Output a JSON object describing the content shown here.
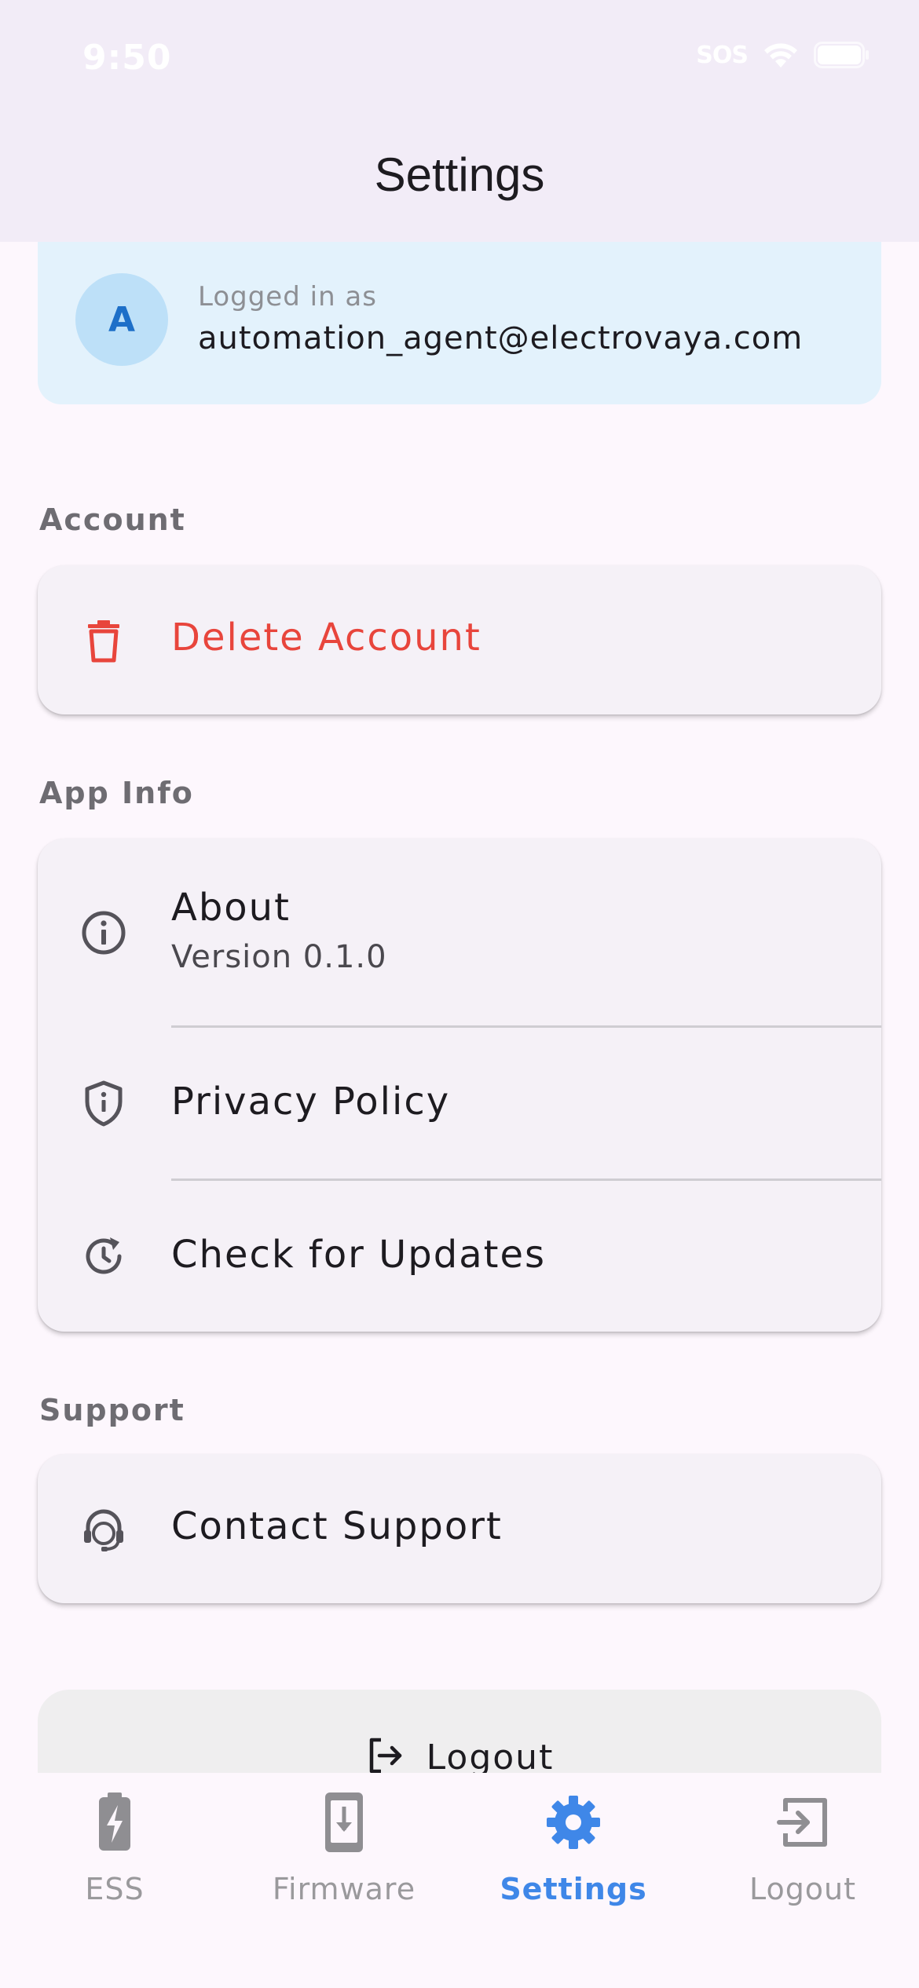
{
  "status_bar": {
    "time": "9:50",
    "sos": "SOS"
  },
  "header": {
    "title": "Settings"
  },
  "user": {
    "avatar_letter": "A",
    "logged_in_label": "Logged in as",
    "email": "automation_agent@electrovaya.com"
  },
  "sections": {
    "account": {
      "label": "Account",
      "delete_label": "Delete Account"
    },
    "app_info": {
      "label": "App Info",
      "about_title": "About",
      "about_version": "Version 0.1.0",
      "privacy_label": "Privacy Policy",
      "updates_label": "Check for Updates"
    },
    "support": {
      "label": "Support",
      "contact_label": "Contact Support"
    }
  },
  "logout_button": {
    "label": "Logout"
  },
  "bottom_nav": {
    "items": [
      {
        "label": "ESS",
        "icon": "battery-charging-icon"
      },
      {
        "label": "Firmware",
        "icon": "phone-download-icon"
      },
      {
        "label": "Settings",
        "icon": "gear-icon"
      },
      {
        "label": "Logout",
        "icon": "logout-icon"
      }
    ],
    "active_index": 2
  },
  "colors": {
    "accent": "#3f87e8",
    "danger": "#e8453c",
    "app_bar": "#f2ecf7",
    "user_card": "#e3f2fc"
  }
}
